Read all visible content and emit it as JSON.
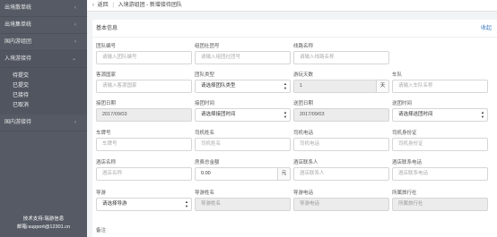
{
  "sidebar": {
    "items": [
      {
        "label": "出境散单统",
        "open": false
      },
      {
        "label": "出境集单统",
        "open": false
      },
      {
        "label": "国内游组团",
        "open": false
      },
      {
        "label": "入境游接待",
        "open": true
      },
      {
        "label": "国内游接待",
        "open": false
      }
    ],
    "submenu": [
      "待提交",
      "已提交",
      "已接待",
      "已取消"
    ],
    "footer_line1": "技术支持:瑞游信息",
    "footer_line2": "邮箱:support@12301.cn"
  },
  "topbar": {
    "back_label": "返回",
    "crumb1": "入境游组团 - 新增接待团队"
  },
  "panel": {
    "title": "基本信息",
    "collapse_label": "收起"
  },
  "form": {
    "rows": [
      [
        {
          "label": "团队编号",
          "placeholder": "请输入团队编号",
          "type": "input"
        },
        {
          "label": "组团社团号",
          "placeholder": "请输入组团社团号",
          "type": "input"
        },
        {
          "label": "线路名称",
          "placeholder": "请输入线路名称",
          "type": "input"
        }
      ],
      [
        {
          "label": "客源国家",
          "placeholder": "请输入客源国家",
          "type": "input"
        },
        {
          "label": "团队类型",
          "value": "请选择团队类型",
          "type": "select"
        },
        {
          "label": "游玩天数",
          "value": "1",
          "suffix": "天",
          "type": "disabled-suffix"
        },
        {
          "label": "车队",
          "placeholder": "请输入车队名称",
          "type": "input"
        }
      ],
      [
        {
          "label": "接团日期",
          "value": "2017/09/03",
          "type": "disabled"
        },
        {
          "label": "接团时间",
          "value": "请选择接团时间",
          "type": "select"
        },
        {
          "label": "送团日期",
          "value": "2017/09/03",
          "type": "disabled"
        },
        {
          "label": "送团时间",
          "value": "请选择送团时间",
          "type": "select"
        }
      ],
      [
        {
          "label": "车牌号",
          "placeholder": "车牌号",
          "type": "input"
        },
        {
          "label": "司机姓名",
          "placeholder": "司机姓名",
          "type": "input"
        },
        {
          "label": "司机电话",
          "placeholder": "司机电话",
          "type": "input"
        },
        {
          "label": "司机身份证",
          "placeholder": "司机身份证",
          "type": "input"
        }
      ],
      [
        {
          "label": "酒店名称",
          "placeholder": "酒店名称",
          "type": "input"
        },
        {
          "label": "房费总金额",
          "value": "0.00",
          "suffix": "元",
          "type": "input-suffix"
        },
        {
          "label": "酒店联系人",
          "placeholder": "酒店联系人",
          "type": "input"
        },
        {
          "label": "酒店联系电话",
          "placeholder": "酒店联系电话",
          "type": "input"
        }
      ],
      [
        {
          "label": "导游",
          "value": "请选择导游",
          "type": "select"
        },
        {
          "label": "导游姓名",
          "placeholder": "导游姓名",
          "type": "disabled"
        },
        {
          "label": "导游电话",
          "placeholder": "导游电话",
          "type": "disabled"
        },
        {
          "label": "所属旅行社",
          "placeholder": "所属旅行社",
          "type": "disabled"
        }
      ]
    ],
    "remark_label": "备注"
  }
}
